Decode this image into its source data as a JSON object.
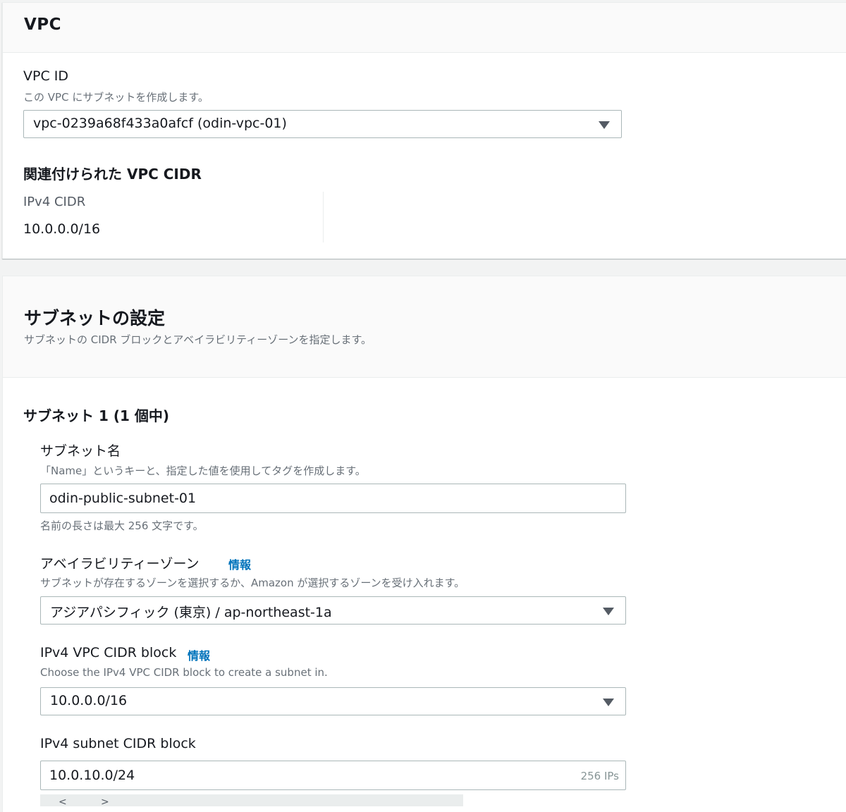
{
  "vpc_section": {
    "title": "VPC",
    "vpc_id_label": "VPC ID",
    "vpc_id_description": "この VPC にサブネットを作成します。",
    "vpc_id_value": "vpc-0239a68f433a0afcf (odin-vpc-01)",
    "associated_cidr_heading": "関連付けられた VPC CIDR",
    "ipv4_cidr_label": "IPv4 CIDR",
    "ipv4_cidr_value": "10.0.0.0/16"
  },
  "subnet_settings": {
    "title": "サブネットの設定",
    "description": "サブネットの CIDR ブロックとアベイラビリティーゾーンを指定します。",
    "subnet_heading": "サブネット 1 (1 個中)",
    "subnet_name": {
      "label": "サブネット名",
      "description": "「Name」というキーと、指定した値を使用してタグを作成します。",
      "value": "odin-public-subnet-01",
      "constraint": "名前の長さは最大 256 文字です。"
    },
    "availability_zone": {
      "label": "アベイラビリティーゾーン",
      "info": "情報",
      "description": "サブネットが存在するゾーンを選択するか、Amazon が選択するゾーンを受け入れます。",
      "value": "アジアパシフィック (東京) / ap-northeast-1a"
    },
    "ipv4_vpc_cidr_block": {
      "label": "IPv4 VPC CIDR block",
      "info": "情報",
      "description": "Choose the IPv4 VPC CIDR block to create a subnet in.",
      "value": "10.0.0.0/16"
    },
    "ipv4_subnet_cidr_block": {
      "label": "IPv4 subnet CIDR block",
      "value": "10.0.10.0/24",
      "suffix": "256 IPs"
    }
  },
  "colors": {
    "background": "#f2f3f3",
    "panel": "#ffffff",
    "header_bg": "#fafafa",
    "link": "#0073bb",
    "text": "#16191f",
    "muted": "#687078",
    "border": "#aab7b8"
  },
  "icons": [
    "caret-down-icon"
  ]
}
